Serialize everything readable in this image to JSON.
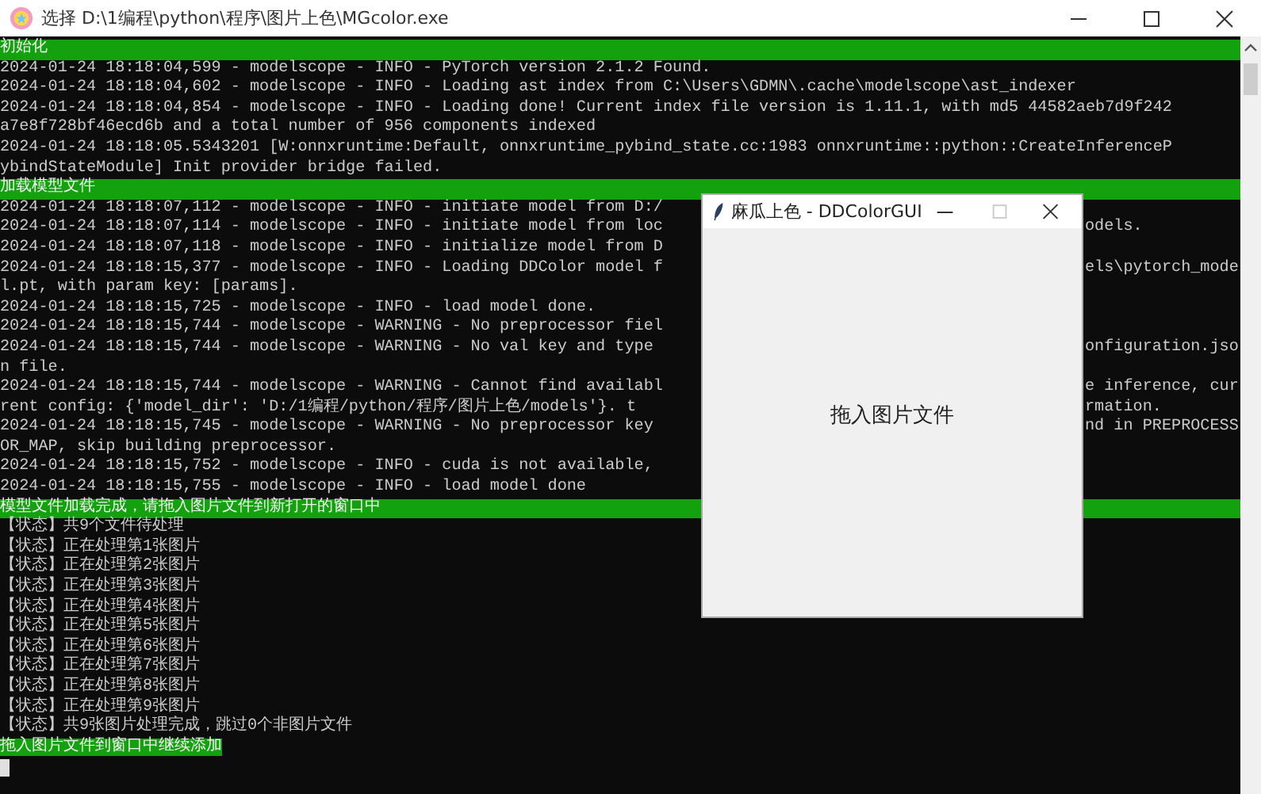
{
  "window": {
    "title": "选择 D:\\1编程\\python\\程序\\图片上色\\MGcolor.exe"
  },
  "console": {
    "lines": [
      {
        "kind": "header",
        "text": "初始化"
      },
      {
        "kind": "text",
        "text": "2024-01-24 18:18:04,599 - modelscope - INFO - PyTorch version 2.1.2 Found."
      },
      {
        "kind": "text",
        "text": "2024-01-24 18:18:04,602 - modelscope - INFO - Loading ast index from C:\\Users\\GDMN\\.cache\\modelscope\\ast_indexer"
      },
      {
        "kind": "text",
        "text": "2024-01-24 18:18:04,854 - modelscope - INFO - Loading done! Current index file version is 1.11.1, with md5 44582aeb7d9f242"
      },
      {
        "kind": "text",
        "text": "a7e8f728bf46ecd6b and a total number of 956 components indexed"
      },
      {
        "kind": "text",
        "text": "2024-01-24 18:18:05.5343201 [W:onnxruntime:Default, onnxruntime_pybind_state.cc:1983 onnxruntime::python::CreateInferenceP"
      },
      {
        "kind": "text",
        "text": "ybindStateModule] Init provider bridge failed."
      },
      {
        "kind": "header",
        "text": "加载模型文件"
      },
      {
        "kind": "text",
        "text": "2024-01-24 18:18:07,112 - modelscope - INFO - initiate model from D:/"
      },
      {
        "kind": "text",
        "text": "2024-01-24 18:18:07,114 - modelscope - INFO - initiate model from loc",
        "right": "odels."
      },
      {
        "kind": "text",
        "text": "2024-01-24 18:18:07,118 - modelscope - INFO - initialize model from D"
      },
      {
        "kind": "text",
        "text": "2024-01-24 18:18:15,377 - modelscope - INFO - Loading DDColor model f",
        "right": "els\\pytorch_mode"
      },
      {
        "kind": "text",
        "text": "l.pt, with param key: [params]."
      },
      {
        "kind": "text",
        "text": "2024-01-24 18:18:15,725 - modelscope - INFO - load model done."
      },
      {
        "kind": "text",
        "text": "2024-01-24 18:18:15,744 - modelscope - WARNING - No preprocessor fiel"
      },
      {
        "kind": "text",
        "text": "2024-01-24 18:18:15,744 - modelscope - WARNING - No val key and type",
        "right": "onfiguration.jso"
      },
      {
        "kind": "text",
        "text": "n file."
      },
      {
        "kind": "text",
        "text": "2024-01-24 18:18:15,744 - modelscope - WARNING - Cannot find availabl",
        "right": "e inference, cur"
      },
      {
        "kind": "text",
        "text": "rent config: {'model_dir': 'D:/1编程/python/程序/图片上色/models'}. t",
        "right": "rmation."
      },
      {
        "kind": "text",
        "text": "2024-01-24 18:18:15,745 - modelscope - WARNING - No preprocessor key",
        "right": "nd in PREPROCESS"
      },
      {
        "kind": "text",
        "text": "OR_MAP, skip building preprocessor."
      },
      {
        "kind": "text",
        "text": "2024-01-24 18:18:15,752 - modelscope - INFO - cuda is not available,"
      },
      {
        "kind": "text",
        "text": "2024-01-24 18:18:15,755 - modelscope - INFO - load model done"
      },
      {
        "kind": "header",
        "text": "模型文件加载完成，请拖入图片文件到新打开的窗口中"
      },
      {
        "kind": "text",
        "text": "【状态】共9个文件待处理"
      },
      {
        "kind": "text",
        "text": "【状态】正在处理第1张图片"
      },
      {
        "kind": "text",
        "text": "【状态】正在处理第2张图片"
      },
      {
        "kind": "text",
        "text": "【状态】正在处理第3张图片"
      },
      {
        "kind": "text",
        "text": "【状态】正在处理第4张图片"
      },
      {
        "kind": "text",
        "text": "【状态】正在处理第5张图片"
      },
      {
        "kind": "text",
        "text": "【状态】正在处理第6张图片"
      },
      {
        "kind": "text",
        "text": "【状态】正在处理第7张图片"
      },
      {
        "kind": "text",
        "text": "【状态】正在处理第8张图片"
      },
      {
        "kind": "text",
        "text": "【状态】正在处理第9张图片"
      },
      {
        "kind": "text",
        "text": "【状态】共9张图片处理完成，跳过0个非图片文件"
      },
      {
        "kind": "highlight",
        "text": "拖入图片文件到窗口中继续添加"
      }
    ]
  },
  "dialog": {
    "title": "麻瓜上色 - DDColorGUI",
    "prompt": "拖入图片文件"
  }
}
